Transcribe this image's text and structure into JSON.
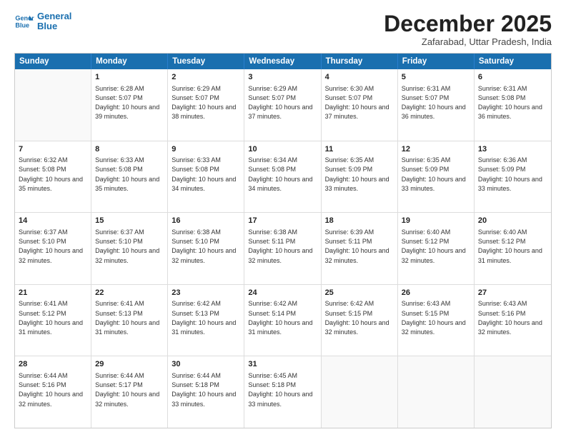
{
  "header": {
    "logo_line1": "General",
    "logo_line2": "Blue",
    "month": "December 2025",
    "location": "Zafarabad, Uttar Pradesh, India"
  },
  "weekdays": [
    "Sunday",
    "Monday",
    "Tuesday",
    "Wednesday",
    "Thursday",
    "Friday",
    "Saturday"
  ],
  "rows": [
    [
      {
        "day": "",
        "empty": true
      },
      {
        "day": "1",
        "sunrise": "6:28 AM",
        "sunset": "5:07 PM",
        "daylight": "10 hours and 39 minutes."
      },
      {
        "day": "2",
        "sunrise": "6:29 AM",
        "sunset": "5:07 PM",
        "daylight": "10 hours and 38 minutes."
      },
      {
        "day": "3",
        "sunrise": "6:29 AM",
        "sunset": "5:07 PM",
        "daylight": "10 hours and 37 minutes."
      },
      {
        "day": "4",
        "sunrise": "6:30 AM",
        "sunset": "5:07 PM",
        "daylight": "10 hours and 37 minutes."
      },
      {
        "day": "5",
        "sunrise": "6:31 AM",
        "sunset": "5:07 PM",
        "daylight": "10 hours and 36 minutes."
      },
      {
        "day": "6",
        "sunrise": "6:31 AM",
        "sunset": "5:08 PM",
        "daylight": "10 hours and 36 minutes."
      }
    ],
    [
      {
        "day": "7",
        "sunrise": "6:32 AM",
        "sunset": "5:08 PM",
        "daylight": "10 hours and 35 minutes."
      },
      {
        "day": "8",
        "sunrise": "6:33 AM",
        "sunset": "5:08 PM",
        "daylight": "10 hours and 35 minutes."
      },
      {
        "day": "9",
        "sunrise": "6:33 AM",
        "sunset": "5:08 PM",
        "daylight": "10 hours and 34 minutes."
      },
      {
        "day": "10",
        "sunrise": "6:34 AM",
        "sunset": "5:08 PM",
        "daylight": "10 hours and 34 minutes."
      },
      {
        "day": "11",
        "sunrise": "6:35 AM",
        "sunset": "5:09 PM",
        "daylight": "10 hours and 33 minutes."
      },
      {
        "day": "12",
        "sunrise": "6:35 AM",
        "sunset": "5:09 PM",
        "daylight": "10 hours and 33 minutes."
      },
      {
        "day": "13",
        "sunrise": "6:36 AM",
        "sunset": "5:09 PM",
        "daylight": "10 hours and 33 minutes."
      }
    ],
    [
      {
        "day": "14",
        "sunrise": "6:37 AM",
        "sunset": "5:10 PM",
        "daylight": "10 hours and 32 minutes."
      },
      {
        "day": "15",
        "sunrise": "6:37 AM",
        "sunset": "5:10 PM",
        "daylight": "10 hours and 32 minutes."
      },
      {
        "day": "16",
        "sunrise": "6:38 AM",
        "sunset": "5:10 PM",
        "daylight": "10 hours and 32 minutes."
      },
      {
        "day": "17",
        "sunrise": "6:38 AM",
        "sunset": "5:11 PM",
        "daylight": "10 hours and 32 minutes."
      },
      {
        "day": "18",
        "sunrise": "6:39 AM",
        "sunset": "5:11 PM",
        "daylight": "10 hours and 32 minutes."
      },
      {
        "day": "19",
        "sunrise": "6:40 AM",
        "sunset": "5:12 PM",
        "daylight": "10 hours and 32 minutes."
      },
      {
        "day": "20",
        "sunrise": "6:40 AM",
        "sunset": "5:12 PM",
        "daylight": "10 hours and 31 minutes."
      }
    ],
    [
      {
        "day": "21",
        "sunrise": "6:41 AM",
        "sunset": "5:12 PM",
        "daylight": "10 hours and 31 minutes."
      },
      {
        "day": "22",
        "sunrise": "6:41 AM",
        "sunset": "5:13 PM",
        "daylight": "10 hours and 31 minutes."
      },
      {
        "day": "23",
        "sunrise": "6:42 AM",
        "sunset": "5:13 PM",
        "daylight": "10 hours and 31 minutes."
      },
      {
        "day": "24",
        "sunrise": "6:42 AM",
        "sunset": "5:14 PM",
        "daylight": "10 hours and 31 minutes."
      },
      {
        "day": "25",
        "sunrise": "6:42 AM",
        "sunset": "5:15 PM",
        "daylight": "10 hours and 32 minutes."
      },
      {
        "day": "26",
        "sunrise": "6:43 AM",
        "sunset": "5:15 PM",
        "daylight": "10 hours and 32 minutes."
      },
      {
        "day": "27",
        "sunrise": "6:43 AM",
        "sunset": "5:16 PM",
        "daylight": "10 hours and 32 minutes."
      }
    ],
    [
      {
        "day": "28",
        "sunrise": "6:44 AM",
        "sunset": "5:16 PM",
        "daylight": "10 hours and 32 minutes."
      },
      {
        "day": "29",
        "sunrise": "6:44 AM",
        "sunset": "5:17 PM",
        "daylight": "10 hours and 32 minutes."
      },
      {
        "day": "30",
        "sunrise": "6:44 AM",
        "sunset": "5:18 PM",
        "daylight": "10 hours and 33 minutes."
      },
      {
        "day": "31",
        "sunrise": "6:45 AM",
        "sunset": "5:18 PM",
        "daylight": "10 hours and 33 minutes."
      },
      {
        "day": "",
        "empty": true
      },
      {
        "day": "",
        "empty": true
      },
      {
        "day": "",
        "empty": true
      }
    ]
  ]
}
